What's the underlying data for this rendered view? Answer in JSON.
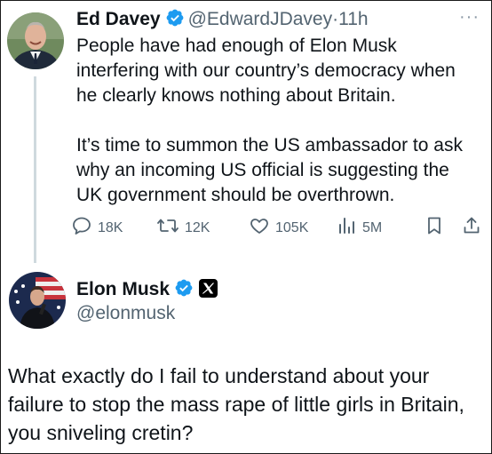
{
  "tweet1": {
    "name": "Ed Davey",
    "handle": "@EdwardJDavey",
    "dot": "·",
    "time": "11h",
    "more": "···",
    "paragraphs": [
      "People have had enough of Elon Musk interfering with our country’s democracy when he clearly knows nothing about Britain.",
      "It’s time to summon the US ambassador to ask why an incoming US official is suggesting the UK government should be overthrown."
    ],
    "actions": {
      "replies": "18K",
      "reposts": "12K",
      "likes": "105K",
      "views": "5M"
    }
  },
  "tweet2": {
    "name": "Elon Musk",
    "handle": "@elonmusk",
    "text": "What exactly do I fail to understand about your failure to stop the mass rape of little girls in Britain, you sniveling cretin?"
  },
  "colors": {
    "verified_blue": "#1d9bf0",
    "secondary_text": "#536471",
    "thread_line": "#cfd9de"
  },
  "icons": [
    "verified-badge-icon",
    "more-icon",
    "reply-icon",
    "repost-icon",
    "like-icon",
    "views-icon",
    "bookmark-icon",
    "share-icon",
    "x-logo-icon"
  ]
}
